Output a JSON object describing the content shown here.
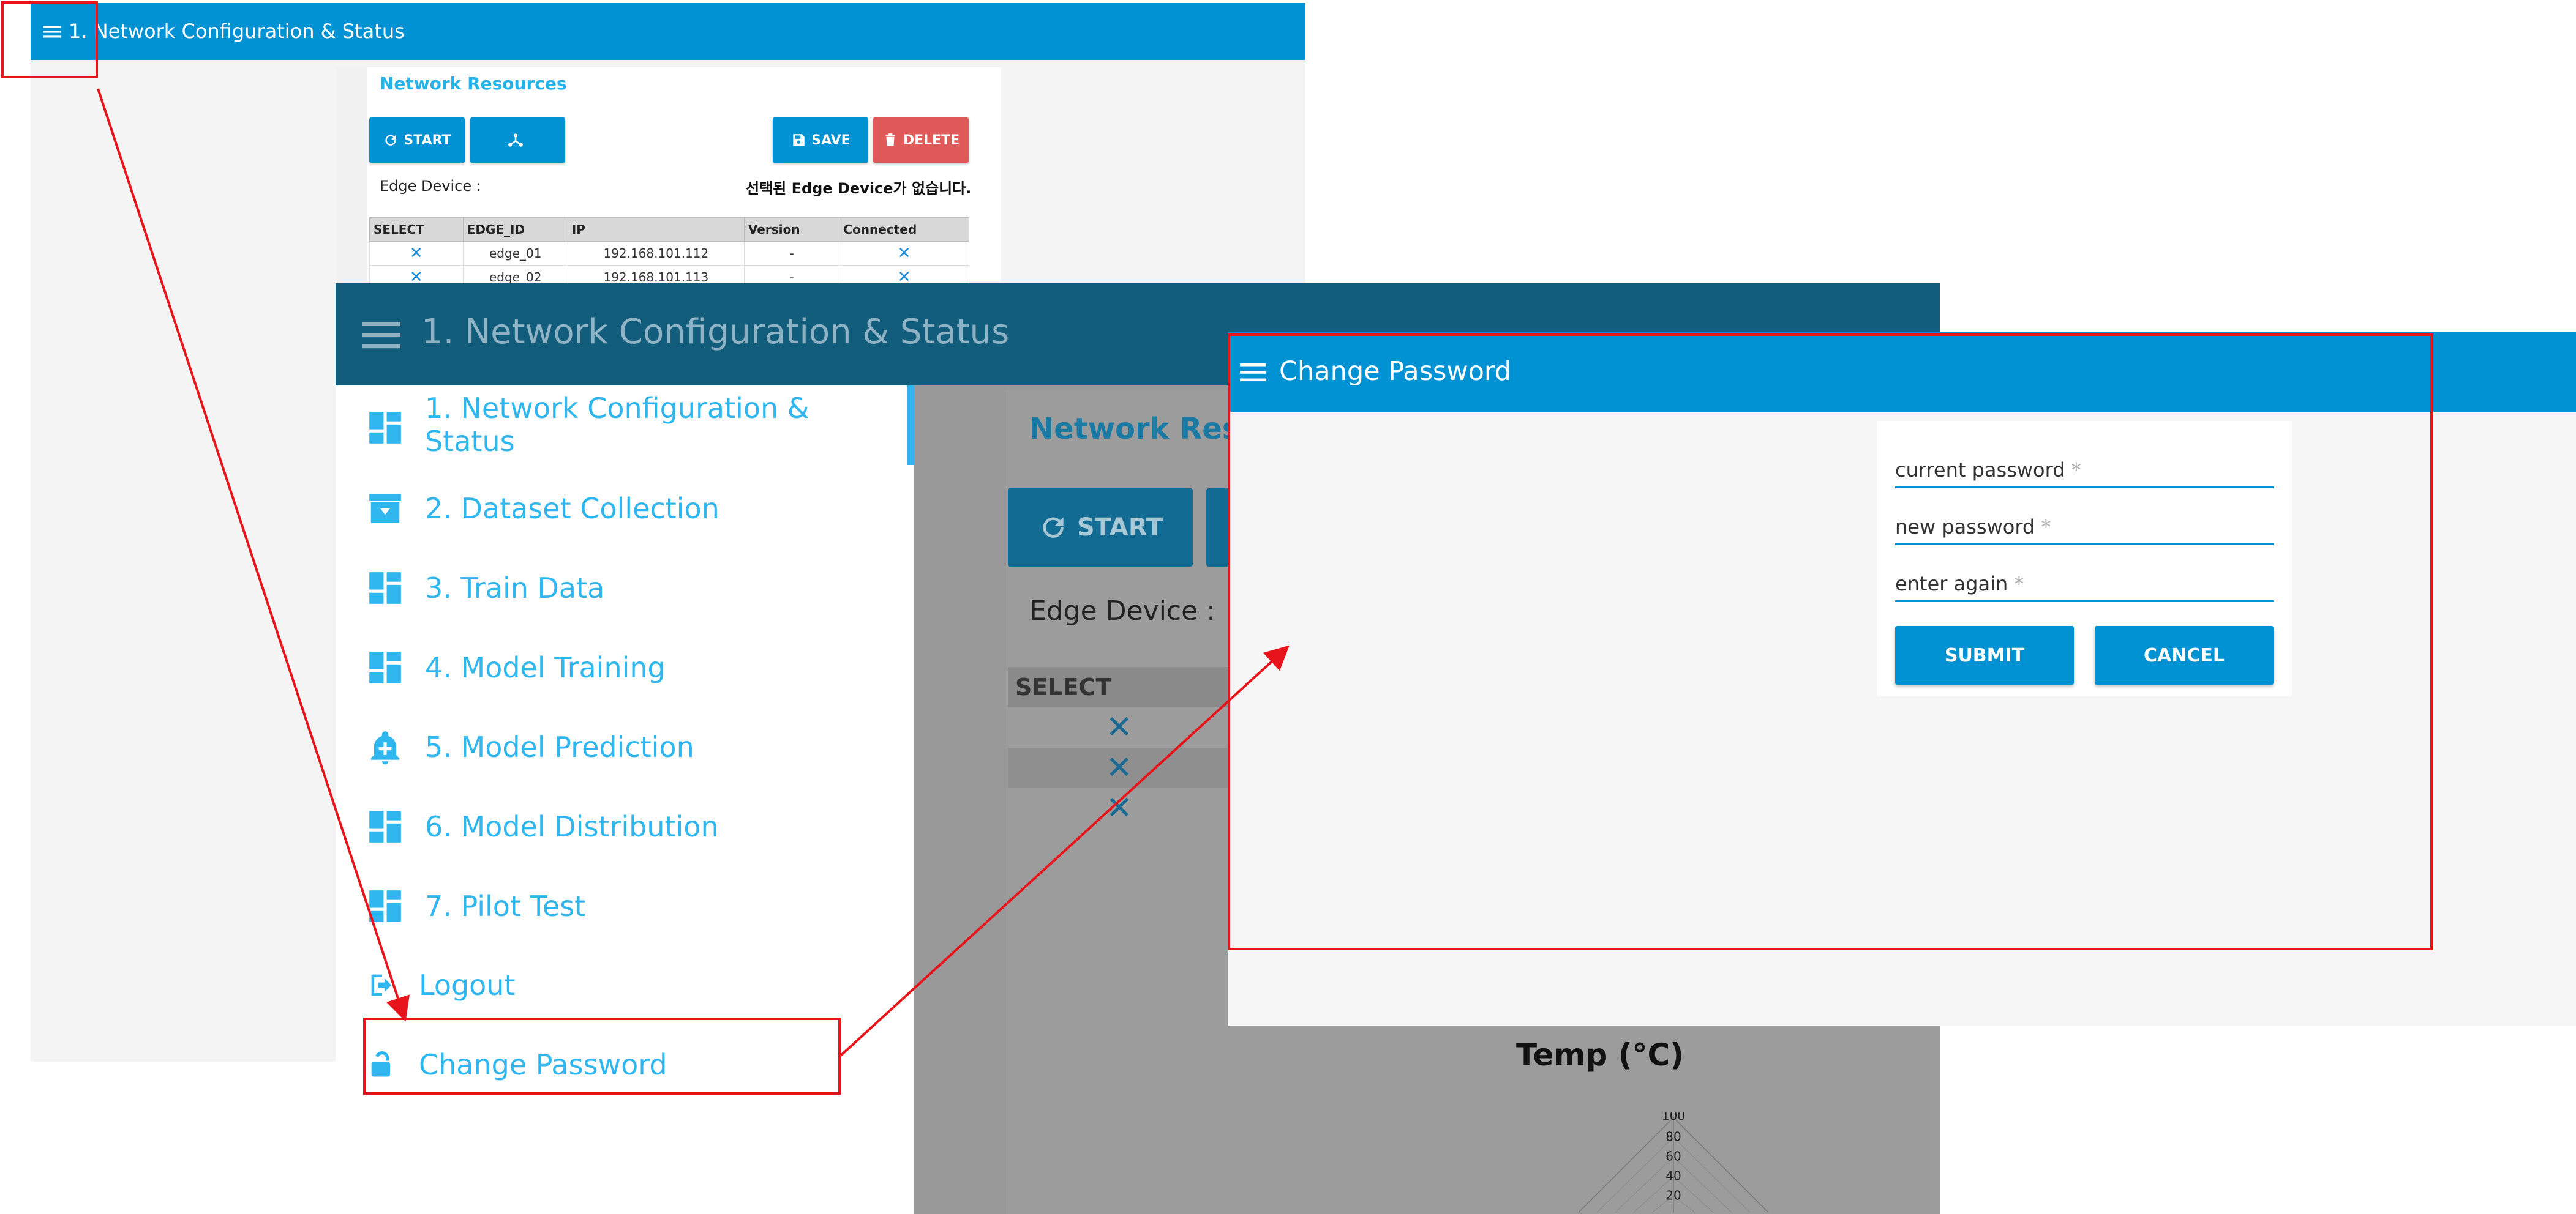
{
  "screen1": {
    "app_title": "1. Network Configuration & Status",
    "section_title": "Network Resources",
    "buttons": {
      "start": "START",
      "save": "SAVE",
      "delete": "DELETE"
    },
    "edge_device_label": "Edge Device :",
    "edge_device_msg": "선택된 Edge Device가 없습니다.",
    "table": {
      "columns": [
        "SELECT",
        "EDGE_ID",
        "IP",
        "Version",
        "Connected"
      ],
      "rows": [
        {
          "edge_id": "edge_01",
          "ip": "192.168.101.112",
          "version": "-"
        },
        {
          "edge_id": "edge_02",
          "ip": "192.168.101.113",
          "version": "-"
        }
      ]
    }
  },
  "screen2": {
    "app_title": "1. Network Configuration & Status",
    "nav": {
      "items": [
        {
          "label": "1. Network Configuration &",
          "label2": "Status"
        },
        {
          "label": "2. Dataset Collection"
        },
        {
          "label": "3. Train Data"
        },
        {
          "label": "4. Model Training"
        },
        {
          "label": "5. Model Prediction"
        },
        {
          "label": "6. Model Distribution"
        },
        {
          "label": "7. Pilot Test"
        }
      ],
      "logout": "Logout",
      "change_password": "Change Password"
    },
    "content": {
      "section_title": "Network Res",
      "start": "START",
      "edge_device_label": "Edge Device :",
      "select_header": "SELECT",
      "chart_title": "Temp (°C)",
      "radar_ticks": [
        "100",
        "80",
        "60",
        "40",
        "20"
      ]
    }
  },
  "screen3": {
    "app_title": "Change Password",
    "fields": {
      "current": "current password",
      "new": "new password",
      "again": "enter again",
      "required_mark": "*"
    },
    "buttons": {
      "submit": "SUBMIT",
      "cancel": "CANCEL"
    }
  },
  "colors": {
    "primary": "#0192d4",
    "dark_appbar": "#135d7c",
    "nav_text": "#2fb6ee",
    "delete": "#e05a5a",
    "annotation": "#e8141b"
  }
}
